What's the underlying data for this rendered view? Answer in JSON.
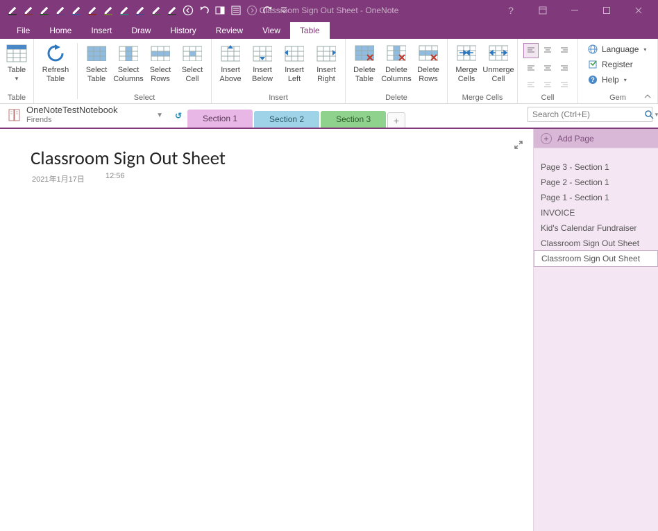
{
  "window": {
    "title": "Classroom Sign Out Sheet - OneNote"
  },
  "qat_pen_colors": [
    "#333333",
    "#82393e",
    "#2a5a2a",
    "#6a3e7a",
    "#3e5a98",
    "#8a2a2a",
    "#7a7a32",
    "#3a7a7a",
    "#4a4a8a",
    "#555555",
    "#3a3a3a"
  ],
  "menu": {
    "items": [
      "File",
      "Home",
      "Insert",
      "Draw",
      "History",
      "Review",
      "View",
      "Table"
    ],
    "active": "Table"
  },
  "ribbon": {
    "groups": {
      "table": {
        "label": "Table",
        "buttons": {
          "table": "Table"
        }
      },
      "refresh": {
        "label": "",
        "buttons": {
          "refresh": "Refresh\nTable"
        }
      },
      "select": {
        "label": "Select",
        "buttons": {
          "sel_table": "Select\nTable",
          "sel_cols": "Select\nColumns",
          "sel_rows": "Select\nRows",
          "sel_cell": "Select\nCell"
        }
      },
      "insert": {
        "label": "Insert",
        "buttons": {
          "above": "Insert\nAbove",
          "below": "Insert\nBelow",
          "left": "Insert\nLeft",
          "right": "Insert\nRight"
        }
      },
      "delete": {
        "label": "Delete",
        "buttons": {
          "del_table": "Delete\nTable",
          "del_cols": "Delete\nColumns",
          "del_rows": "Delete\nRows"
        }
      },
      "merge": {
        "label": "Merge Cells",
        "buttons": {
          "merge": "Merge\nCells",
          "unmerge": "Unmerge\nCell"
        }
      },
      "cell": {
        "label": "Cell"
      },
      "gem": {
        "label": "Gem",
        "items": {
          "language": "Language",
          "register": "Register",
          "help": "Help"
        }
      }
    }
  },
  "notebook": {
    "name": "OneNoteTestNotebook",
    "sub": "Firends",
    "sync_glyph": "↺"
  },
  "sections": [
    "Section 1",
    "Section 2",
    "Section 3"
  ],
  "search": {
    "placeholder": "Search (Ctrl+E)"
  },
  "page": {
    "title": "Classroom Sign Out Sheet",
    "date": "2021年1月17日",
    "time": "12:56"
  },
  "pagelist": {
    "add_label": "Add Page",
    "items": [
      "Page 3 - Section 1",
      "Page 2 - Section 1",
      "Page 1 - Section 1",
      "INVOICE",
      "Kid's Calendar Fundraiser",
      "Classroom Sign Out Sheet",
      "Classroom Sign Out Sheet"
    ],
    "selected_index": 6
  }
}
